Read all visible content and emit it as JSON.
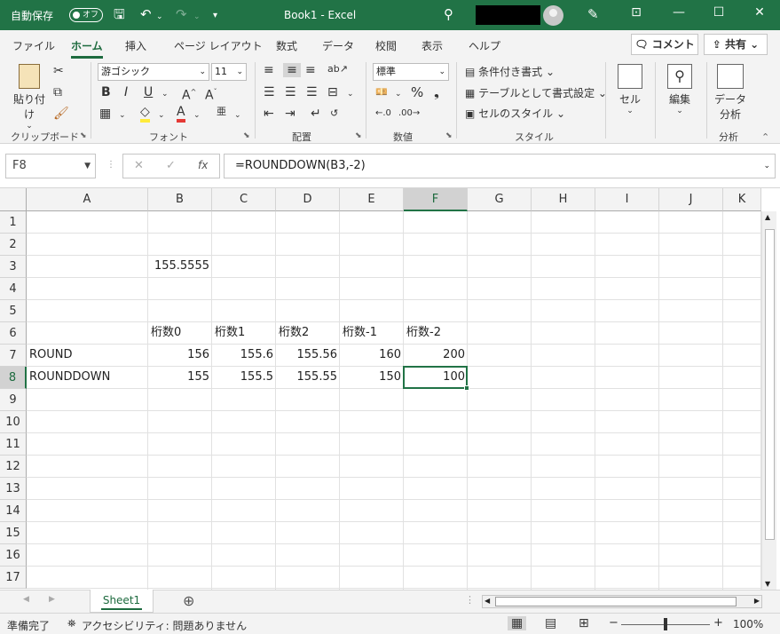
{
  "titlebar": {
    "autosave_label": "自動保存",
    "autosave_state": "オフ",
    "title": "Book1  -  Excel",
    "colors": {
      "bar": "#217346"
    }
  },
  "tabs": [
    "ファイル",
    "ホーム",
    "挿入",
    "ページ レイアウト",
    "数式",
    "データ",
    "校閲",
    "表示",
    "ヘルプ"
  ],
  "active_tab": "ホーム",
  "comment_label": "コメント",
  "share_label": "共有",
  "ribbon": {
    "clipboard": {
      "paste": "貼り付け",
      "group": "クリップボード"
    },
    "font": {
      "family": "游ゴシック",
      "size": "11",
      "group": "フォント"
    },
    "alignment": {
      "group": "配置"
    },
    "number": {
      "format": "標準",
      "group": "数値"
    },
    "styles": {
      "conditional": "条件付き書式",
      "table": "テーブルとして書式設定",
      "cell_styles": "セルのスタイル",
      "group": "スタイル"
    },
    "cells": {
      "label": "セル"
    },
    "editing": {
      "label": "編集"
    },
    "analysis": {
      "label_line1": "データ",
      "label_line2": "分析",
      "group": "分析"
    }
  },
  "formula_bar": {
    "name_box": "F8",
    "formula": "=ROUNDDOWN(B3,-2)"
  },
  "grid": {
    "columns": [
      "A",
      "B",
      "C",
      "D",
      "E",
      "F",
      "G",
      "H",
      "I",
      "J",
      "K"
    ],
    "rows": [
      "1",
      "2",
      "3",
      "4",
      "5",
      "6",
      "7",
      "8",
      "9",
      "10",
      "11",
      "12",
      "13",
      "14",
      "15",
      "16",
      "17"
    ],
    "selected_cell": "F8",
    "cells": {
      "B3": "155.5555",
      "B6": "桁数0",
      "C6": "桁数1",
      "D6": "桁数2",
      "E6": "桁数-1",
      "F6": "桁数-2",
      "A7": "ROUND",
      "B7": "156",
      "C7": "155.6",
      "D7": "155.56",
      "E7": "160",
      "F7": "200",
      "A8": "ROUNDDOWN",
      "B8": "155",
      "C8": "155.5",
      "D8": "155.55",
      "E8": "150",
      "F8": "100"
    }
  },
  "sheets": [
    "Sheet1"
  ],
  "status": {
    "ready": "準備完了",
    "accessibility": "アクセシビリティ: 問題ありません",
    "zoom": "100%"
  }
}
